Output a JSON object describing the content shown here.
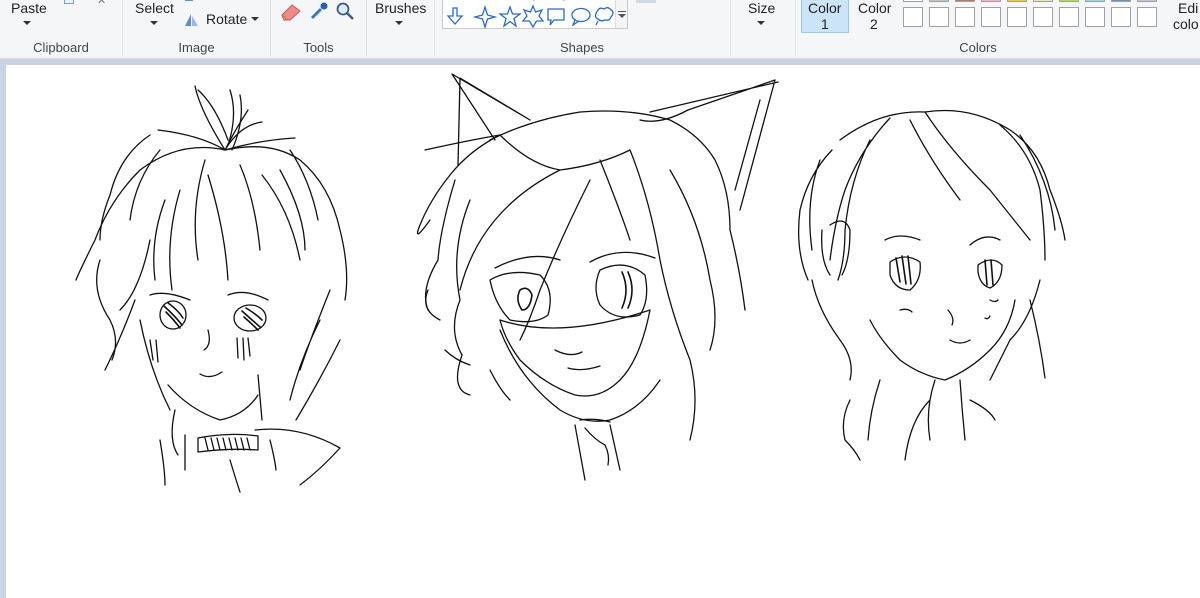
{
  "ribbon": {
    "clipboard": {
      "paste_label": "Paste",
      "group_label": "Clipboard"
    },
    "image": {
      "select_label": "Select",
      "rotate_label": "Rotate",
      "group_label": "Image"
    },
    "tools": {
      "group_label": "Tools"
    },
    "brushes": {
      "label": "Brushes"
    },
    "shapes": {
      "group_label": "Shapes"
    },
    "size": {
      "label": "Size"
    },
    "color1": {
      "label_line1": "Color",
      "label_line2": "1"
    },
    "color2": {
      "label_line1": "Color",
      "label_line2": "2"
    },
    "colors": {
      "group_label": "Colors",
      "edit_line1": "Edi",
      "edit_line2": "colo"
    },
    "palette_top_colors": [
      "#ffffff",
      "#c3c3c3",
      "#b97a57",
      "#ffaec9",
      "#ffc90e",
      "#efe4b0",
      "#b5e61d",
      "#99d9ea",
      "#7092be",
      "#c8bfe7"
    ]
  },
  "canvas": {
    "drawings": [
      "sketch-character-left",
      "sketch-character-cat-ears",
      "sketch-character-right"
    ]
  }
}
